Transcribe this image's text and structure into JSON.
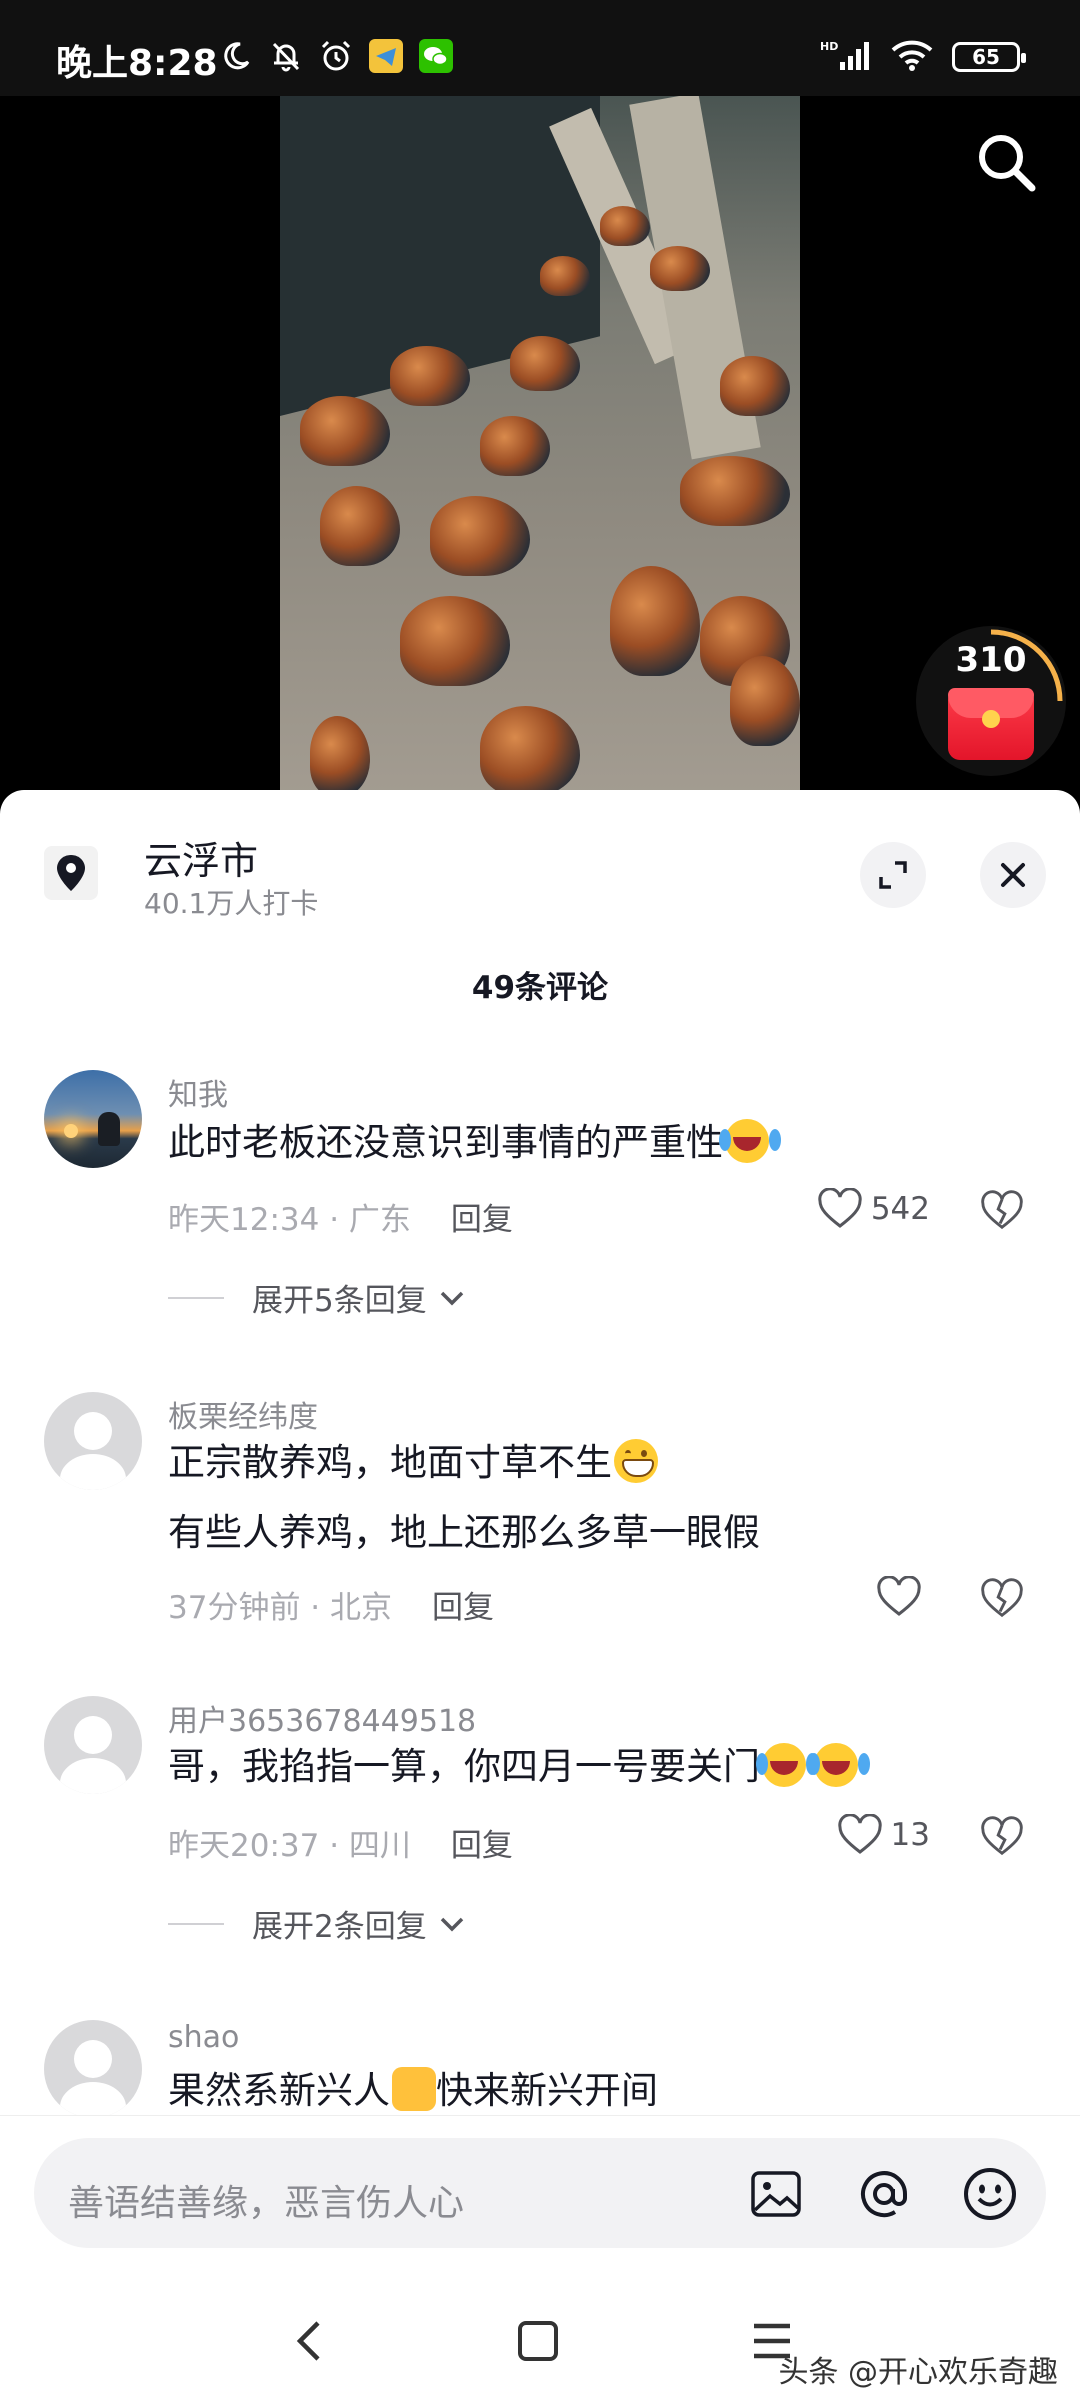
{
  "status_bar": {
    "time": "晚上8:28",
    "battery": "65",
    "network": "HD"
  },
  "video": {
    "redpack_count": "310"
  },
  "location": {
    "name": "云浮市",
    "checkins": "40.1万人打卡"
  },
  "comments_header": "49条评论",
  "comments": [
    {
      "user": "知我",
      "lines": [
        "此时老板还没意识到事情的严重性"
      ],
      "time": "昨天12:34",
      "region": "广东",
      "reply_label": "回复",
      "likes": "542",
      "expand": "展开5条回复"
    },
    {
      "user": "板栗经纬度",
      "lines": [
        "正宗散养鸡，地面寸草不生",
        "有些人养鸡，地上还那么多草一眼假"
      ],
      "time": "37分钟前",
      "region": "北京",
      "reply_label": "回复",
      "likes": ""
    },
    {
      "user": "用户3653678449518",
      "lines": [
        "哥，我掐指一算，你四月一号要关门"
      ],
      "time": "昨天20:37",
      "region": "四川",
      "reply_label": "回复",
      "likes": "13",
      "expand": "展开2条回复"
    },
    {
      "user": "shao",
      "lines": [
        "果然系新兴人",
        "快来新兴开间"
      ]
    }
  ],
  "input": {
    "placeholder": "善语结善缘，恶言伤人心"
  },
  "watermark": "头条 @开心欢乐奇趣",
  "colors": {
    "text_primary": "#161823",
    "text_secondary": "#8a8b91",
    "sheet_bg": "#ffffff",
    "accent_red": "#e3152a"
  }
}
